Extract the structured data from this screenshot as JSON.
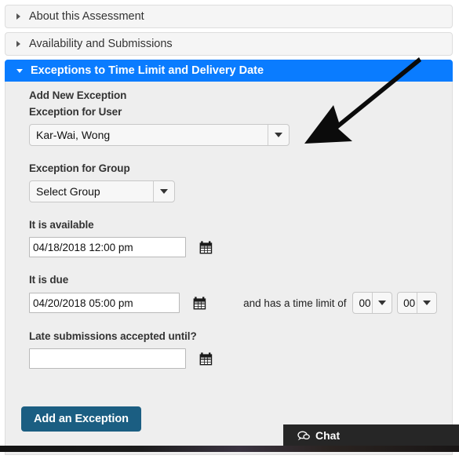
{
  "accordion": {
    "panels": [
      {
        "label": "About this Assessment",
        "expanded": false
      },
      {
        "label": "Availability and Submissions",
        "expanded": false
      },
      {
        "label": "Exceptions to Time Limit and Delivery Date",
        "expanded": true
      }
    ]
  },
  "form": {
    "section_title": "Add New Exception",
    "user_label": "Exception for User",
    "user_value": "Kar-Wai, Wong",
    "group_label": "Exception for Group",
    "group_value": "Select Group",
    "available_label": "It is available",
    "available_value": "04/18/2018 12:00 pm",
    "due_label": "It is due",
    "due_value": "04/20/2018 05:00 pm",
    "time_limit_text": "and has a time limit of",
    "time_limit_hours": "00",
    "time_limit_minutes": "00",
    "late_label": "Late submissions accepted until?",
    "late_value": "",
    "late_placeholder": "",
    "submit_label": "Add an Exception",
    "calendar_icon": "calendar-icon"
  },
  "chat": {
    "label": "Chat",
    "icon": "chat-bubble-icon"
  },
  "annotation": {
    "arrow": "black-pointer-arrow"
  },
  "colors": {
    "accent_blue": "#0a7cff",
    "button_blue": "#1b5e82",
    "panel_gray": "#f5f5f5",
    "body_gray": "#eeeeee",
    "chat_dark": "#262626"
  }
}
